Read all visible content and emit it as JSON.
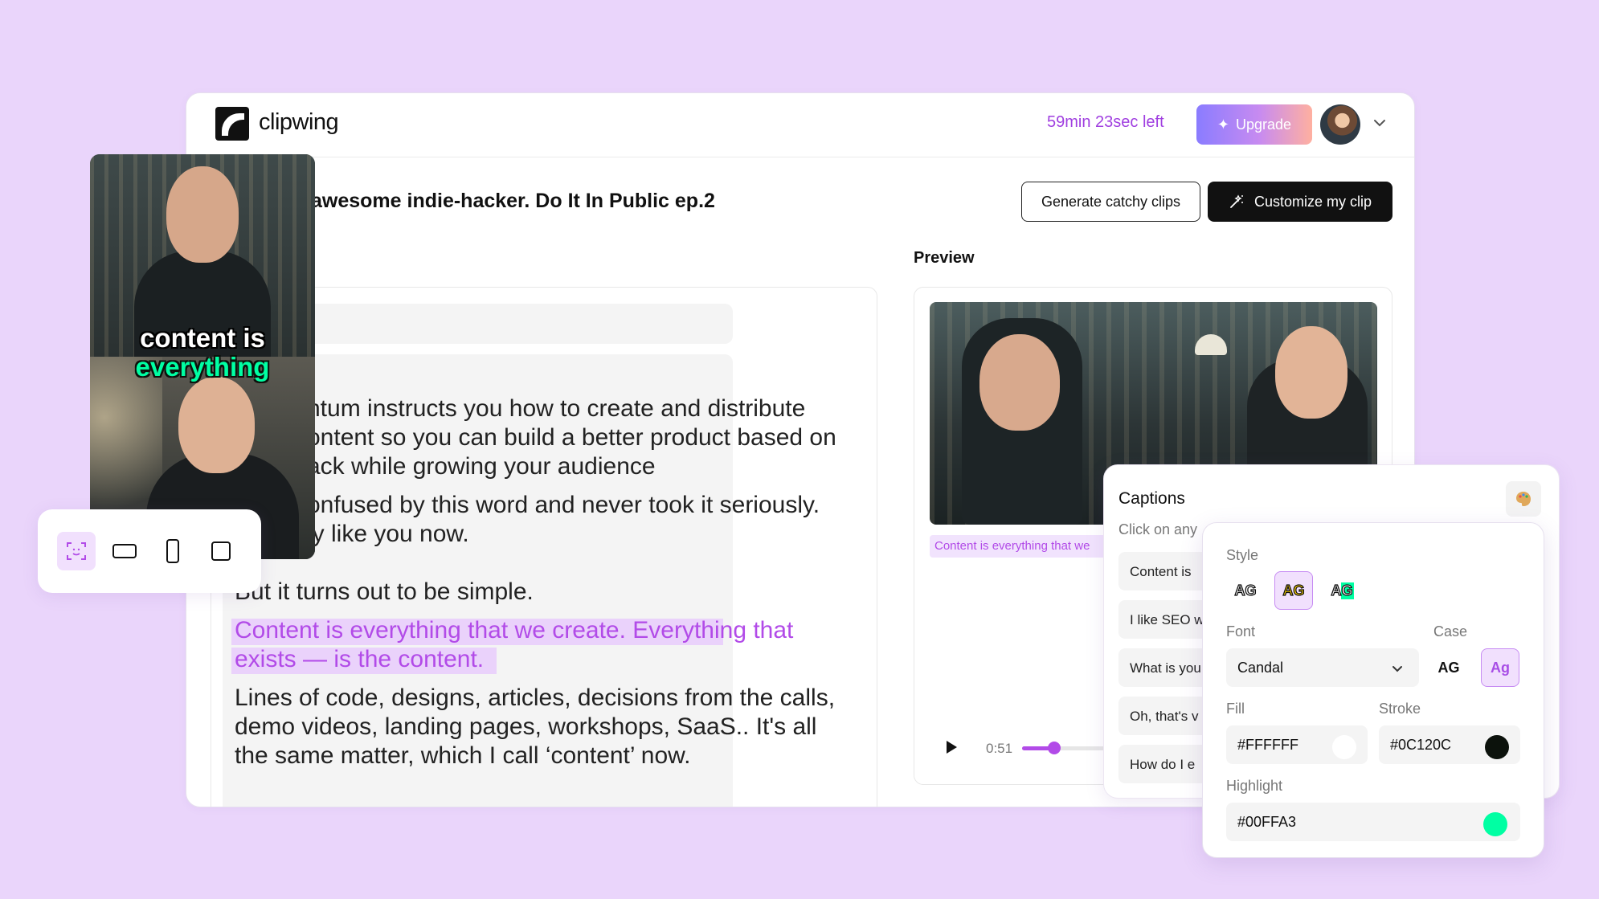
{
  "app": {
    "name": "clipwing",
    "time_left": "59min 23sec left",
    "upgrade_label": "Upgrade"
  },
  "project": {
    "title": "awesome indie-hacker. Do It In Public ep.2",
    "generate_label": "Generate catchy clips",
    "customize_label": "Customize my clip"
  },
  "preview": {
    "label": "Preview",
    "caption_text": "Content is everything that we",
    "time": "0:51",
    "progress": 0.33
  },
  "transcript": {
    "lines": [
      "ntum instructs you how to create and distribute",
      "ontent so you can build a better product based on",
      "ack while growing your audience",
      "onfused by this word and never took it seriously.",
      "ly like you now.",
      "But it turns out to be simple.",
      "Content is everything that we create. Everything that",
      "exists — is the content.",
      "Lines of code, designs, articles, decisions from the calls,",
      "demo videos, landing pages, workshops, SaaS.. It's all",
      "the same matter, which I call ‘content’ now."
    ]
  },
  "clip": {
    "caption_line1": "content is",
    "caption_line2": "everything"
  },
  "captions": {
    "title": "Captions",
    "subtitle": "Click on any",
    "items": [
      "Content is",
      "I like SEO w",
      "What is you",
      "Oh, that's v",
      "How do I e"
    ]
  },
  "style": {
    "style_label": "Style",
    "style_sample": "AG",
    "font_label": "Font",
    "font_value": "Candal",
    "case_label": "Case",
    "case_upper": "AG",
    "case_title": "Ag",
    "fill_label": "Fill",
    "fill_value": "#FFFFFF",
    "stroke_label": "Stroke",
    "stroke_value": "#0C120C",
    "highlight_label": "Highlight",
    "highlight_value": "#00FFA3"
  },
  "colors": {
    "accent": "#b24be8",
    "background": "#ead5fb",
    "fill": "#FFFFFF",
    "stroke": "#0C120C",
    "highlight": "#00FFA3"
  }
}
